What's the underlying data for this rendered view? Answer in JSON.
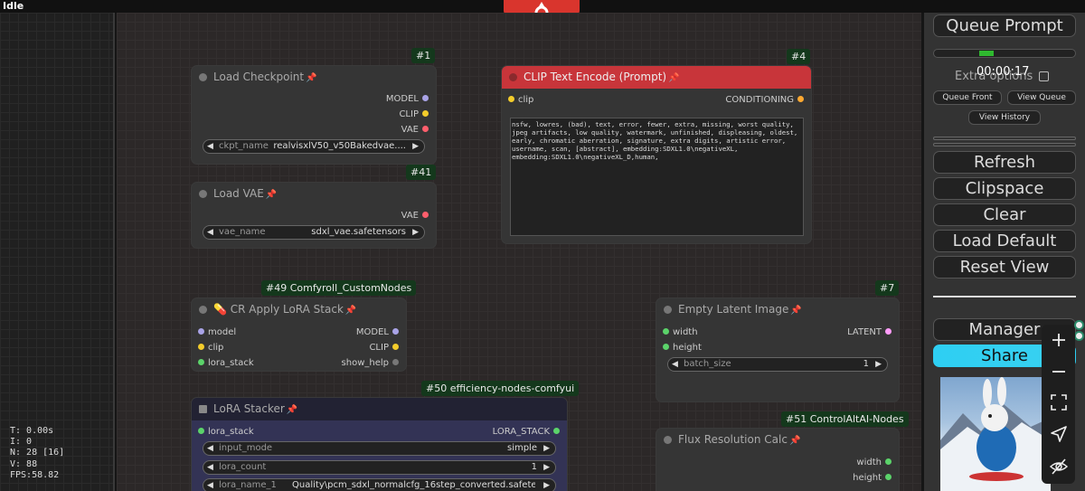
{
  "status": "Idle",
  "stats": {
    "t": "T: 0.00s",
    "i": "I: 0",
    "n": "N: 28 [16]",
    "v": "V: 88",
    "fps": "FPS:58.82"
  },
  "colors": {
    "accent": "#d9352d",
    "share": "#2ecff3",
    "badge": "#14381c",
    "clip_node": "#c8353a"
  },
  "nodes": {
    "checkpoint": {
      "badge": "#1",
      "title": "Load Checkpoint",
      "outputs": [
        "MODEL",
        "CLIP",
        "VAE"
      ],
      "widget": {
        "label": "ckpt_name",
        "value": "realvisxlV50_v50Bakedvae...."
      }
    },
    "clip": {
      "badge": "#4",
      "title": "CLIP Text Encode (Prompt)",
      "input": "clip",
      "output": "CONDITIONING",
      "text": "nsfw, lowres, (bad), text, error, fewer, extra, missing, worst quality, jpeg artifacts, low quality, watermark, unfinished, displeasing, oldest, early, chromatic aberration, signature, extra digits, artistic error, username, scan, [abstract], embedding:SDXL1.0\\negativeXL, embedding:SDXL1.0\\negativeXL_D,human,"
    },
    "vae": {
      "badge": "#41",
      "title": "Load VAE",
      "output": "VAE",
      "widget": {
        "label": "vae_name",
        "value": "sdxl_vae.safetensors"
      }
    },
    "lora_stack": {
      "badge": "#49 Comfyroll_CustomNodes",
      "title": "CR Apply LoRA Stack",
      "inputs": [
        "model",
        "clip",
        "lora_stack"
      ],
      "outputs": [
        "MODEL",
        "CLIP",
        "show_help"
      ]
    },
    "latent": {
      "badge": "#7",
      "title": "Empty Latent Image",
      "inputs": [
        "width",
        "height"
      ],
      "output": "LATENT",
      "widget": {
        "label": "batch_size",
        "value": "1"
      }
    },
    "lora_stacker": {
      "badge": "#50 efficiency-nodes-comfyui",
      "title": "LoRA Stacker",
      "input": "lora_stack",
      "output": "LORA_STACK",
      "widgets": [
        {
          "label": "input_mode",
          "value": "simple"
        },
        {
          "label": "lora_count",
          "value": "1"
        },
        {
          "label": "lora_name_1",
          "value": "Quality\\pcm_sdxl_normalcfg_16step_converted.safeten..."
        }
      ]
    },
    "flux": {
      "badge": "#51 ControlAltAI-Nodes",
      "title": "Flux Resolution Calc",
      "outputs": [
        "width",
        "height"
      ]
    }
  },
  "menu": {
    "queue_prompt": "Queue Prompt",
    "timer": "00:00:17",
    "extra_options": "Extra options",
    "queue_front": "Queue Front",
    "view_queue": "View Queue",
    "view_history": "View History",
    "refresh": "Refresh",
    "clipspace": "Clipspace",
    "clear": "Clear",
    "load_default": "Load Default",
    "reset_view": "Reset View",
    "manager": "Manager",
    "share": "Share"
  },
  "toolbar_icons": [
    "plus-icon",
    "minus-icon",
    "fit-view-icon",
    "send-icon",
    "hide-icon"
  ]
}
